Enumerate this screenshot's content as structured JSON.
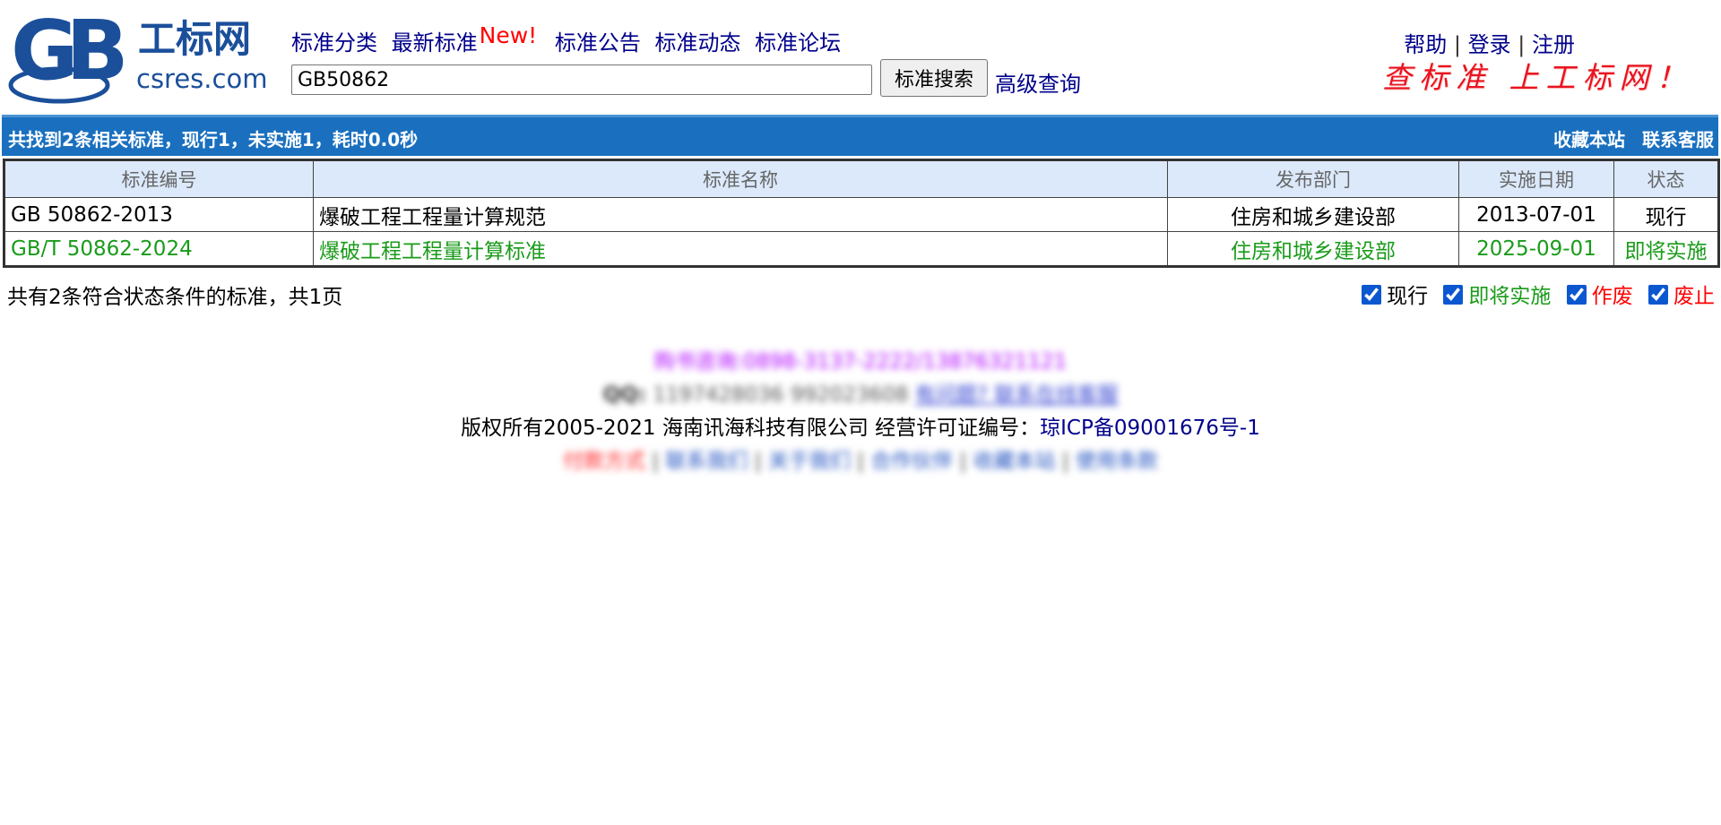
{
  "logo": {
    "mark": "GB",
    "name": "工标网",
    "domain": "csres.com"
  },
  "nav": {
    "items": [
      "标准分类",
      "最新标准",
      "标准公告",
      "标准动态",
      "标准论坛"
    ],
    "new_badge": "New!"
  },
  "search": {
    "value": "GB50862",
    "button_label": "标准搜索",
    "advanced_label": "高级查询"
  },
  "user_links": {
    "help": "帮助",
    "login": "登录",
    "register": "注册",
    "separator": "|"
  },
  "slogan": "查标准 上工标网！",
  "result_bar": {
    "summary": "共找到2条相关标准，现行1，未实施1，耗时0.0秒",
    "favorite": "收藏本站",
    "contact": "联系客服"
  },
  "table": {
    "headers": [
      "标准编号",
      "标准名称",
      "发布部门",
      "实施日期",
      "状态"
    ],
    "rows": [
      {
        "code": "GB 50862-2013",
        "name": "爆破工程工程量计算规范",
        "dept": "住房和城乡建设部",
        "date": "2013-07-01",
        "status": "现行"
      },
      {
        "code": "GB/T 50862-2024",
        "name": "爆破工程工程量计算标准",
        "dept": "住房和城乡建设部",
        "date": "2025-09-01",
        "status": "即将实施"
      }
    ]
  },
  "summary_line": "共有2条符合状态条件的标准，共1页",
  "filters": [
    {
      "label": "现行",
      "checked": true,
      "color": "#000000"
    },
    {
      "label": "即将实施",
      "checked": true,
      "color": "#1a9b1a"
    },
    {
      "label": "作废",
      "checked": true,
      "color": "#ff0000"
    },
    {
      "label": "废止",
      "checked": true,
      "color": "#ff0000"
    }
  ],
  "footer": {
    "phone": "购书咨询:0898-3137-2222/13876321121",
    "qq_prefix": "QQ:",
    "qq_numbers": "1197428036 992023608",
    "qq_link": "有问题? 联系在线客服",
    "copyright": "版权所有2005-2021 海南讯海科技有限公司 经营许可证编号：",
    "icp": "琼ICP备09001676号-1",
    "links": [
      "付款方式",
      "联系我们",
      "关于我们",
      "合作伙伴",
      "收藏本站",
      "使用条款"
    ]
  },
  "colors": {
    "bar": "#1a70bf",
    "header_row": "#dbe9fb",
    "nav_link": "#00008b",
    "upcoming": "#1a9b1a",
    "new_badge": "#ff0000"
  }
}
